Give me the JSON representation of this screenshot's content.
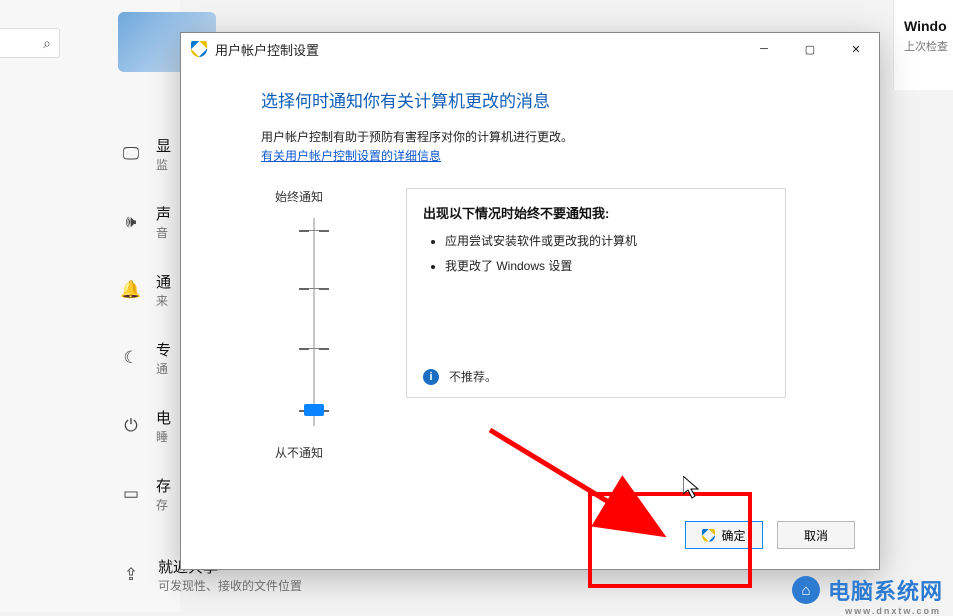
{
  "background": {
    "search_placeholder": "",
    "items": [
      {
        "icon": "monitor",
        "title": "显",
        "sub": "监"
      },
      {
        "icon": "sound",
        "title": "声",
        "sub": "音"
      },
      {
        "icon": "bell",
        "title": "通",
        "sub": "来"
      },
      {
        "icon": "moon",
        "title": "专",
        "sub": "通"
      },
      {
        "icon": "power",
        "title": "电",
        "sub": "睡"
      },
      {
        "icon": "storage",
        "title": "存",
        "sub": "存"
      }
    ],
    "share": {
      "title": "就近共享",
      "sub": "可发现性、接收的文件位置"
    },
    "right_panel": {
      "title": "Windo",
      "sub": "上次检查"
    }
  },
  "dialog": {
    "title": "用户帐户控制设置",
    "heading": "选择何时通知你有关计算机更改的消息",
    "description": "用户帐户控制有助于预防有害程序对你的计算机进行更改。",
    "link_text": "有关用户帐户控制设置的详细信息",
    "slider": {
      "top_label": "始终通知",
      "bottom_label": "从不通知",
      "value": 0,
      "max": 3
    },
    "info": {
      "heading": "出现以下情况时始终不要通知我:",
      "bullets": [
        "应用尝试安装软件或更改我的计算机",
        "我更改了 Windows 设置"
      ],
      "footer": "不推荐。"
    },
    "buttons": {
      "ok": "确定",
      "cancel": "取消"
    }
  },
  "watermark": {
    "text": "电脑系统网",
    "url": "www.dnxtw.com"
  }
}
